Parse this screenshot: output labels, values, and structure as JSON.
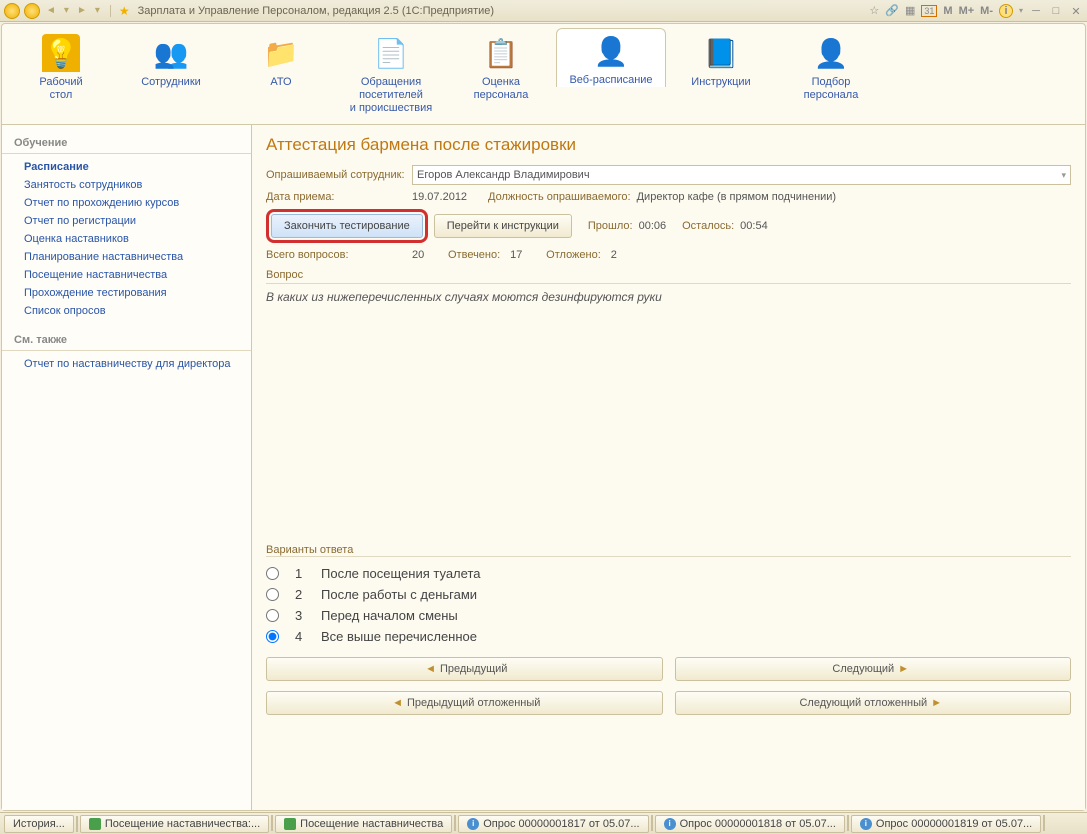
{
  "titlebar": {
    "title": "Зарплата и Управление Персоналом, редакция 2.5  (1С:Предприятие)",
    "m_buttons": [
      "M",
      "M+",
      "M-"
    ]
  },
  "toolbar": {
    "items": [
      {
        "label": "Рабочий\nстол",
        "icon": "desk-lamp"
      },
      {
        "label": "Сотрудники",
        "icon": "people"
      },
      {
        "label": "АТО",
        "icon": "ato"
      },
      {
        "label": "Обращения посетителей\nи происшествия",
        "icon": "doc"
      },
      {
        "label": "Оценка\nперсонала",
        "icon": "clip"
      },
      {
        "label": "Веб-расписание",
        "icon": "man",
        "active": true
      },
      {
        "label": "Инструкции",
        "icon": "instr"
      },
      {
        "label": "Подбор\nперсонала",
        "icon": "plusman"
      }
    ]
  },
  "sidebar": {
    "section1_title": "Обучение",
    "items1": [
      {
        "label": "Расписание",
        "bold": true
      },
      {
        "label": "Занятость сотрудников"
      },
      {
        "label": "Отчет по прохождению курсов"
      },
      {
        "label": "Отчет по регистрации"
      },
      {
        "label": "Оценка наставников"
      },
      {
        "label": "Планирование наставничества"
      },
      {
        "label": "Посещение наставничества"
      },
      {
        "label": "Прохождение тестирования"
      },
      {
        "label": "Список опросов"
      }
    ],
    "section2_title": "См. также",
    "items2": [
      {
        "label": "Отчет по наставничеству для директора"
      }
    ]
  },
  "main": {
    "page_title": "Аттестация бармена после стажировки",
    "labels": {
      "employee": "Опрашиваемый сотрудник:",
      "hire_date": "Дата приема:",
      "position": "Должность опрашиваемого:",
      "total_q": "Всего вопросов:",
      "answered": "Отвечено:",
      "postponed": "Отложено:",
      "elapsed": "Прошло:",
      "remaining": "Осталось:",
      "question_group": "Вопрос",
      "answers_group": "Варианты ответа"
    },
    "values": {
      "employee": "Егоров Александр Владимирович",
      "hire_date": "19.07.2012",
      "position": "Директор кафе (в прямом подчинении)",
      "total_q": "20",
      "answered": "17",
      "postponed": "2",
      "elapsed": "00:06",
      "remaining": "00:54"
    },
    "buttons": {
      "finish": "Закончить тестирование",
      "goto_instruction": "Перейти к инструкции",
      "prev": "Предыдущий",
      "next": "Следующий",
      "prev_postponed": "Предыдущий отложенный",
      "next_postponed": "Следующий отложенный"
    },
    "question": "В каких из нижеперечисленных случаях моются дезинфируются руки",
    "answers": [
      {
        "num": "1",
        "text": "После посещения туалета",
        "checked": false
      },
      {
        "num": "2",
        "text": "После работы с деньгами",
        "checked": false
      },
      {
        "num": "3",
        "text": "Перед началом смены",
        "checked": false
      },
      {
        "num": "4",
        "text": "Все выше перечисленное",
        "checked": true
      }
    ]
  },
  "statusbar": {
    "history": "История...",
    "tabs": [
      {
        "icon": "green",
        "label": "Посещение наставничества:..."
      },
      {
        "icon": "green",
        "label": "Посещение наставничества"
      },
      {
        "icon": "blue",
        "label": "Опрос 00000001817 от 05.07..."
      },
      {
        "icon": "blue",
        "label": "Опрос 00000001818 от 05.07..."
      },
      {
        "icon": "blue",
        "label": "Опрос 00000001819 от 05.07..."
      }
    ]
  }
}
